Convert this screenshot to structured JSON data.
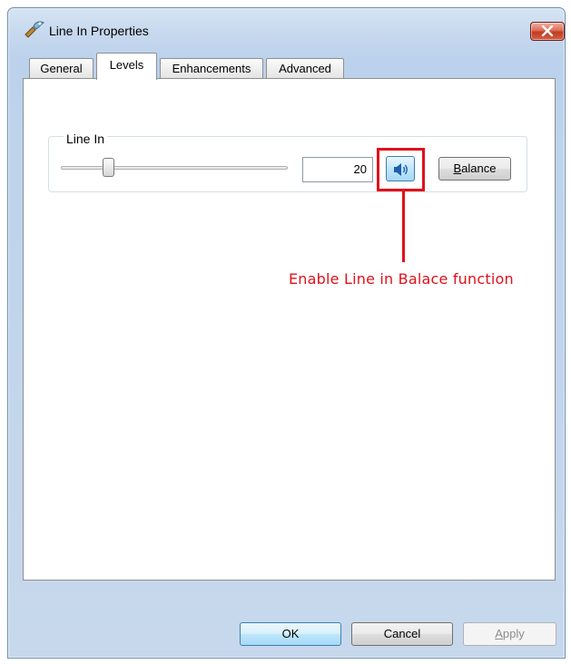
{
  "window": {
    "title": "Line In Properties",
    "icon": "speaker-properties-icon"
  },
  "tabs": [
    {
      "label": "General",
      "active": false
    },
    {
      "label": "Levels",
      "active": true
    },
    {
      "label": "Enhancements",
      "active": false
    },
    {
      "label": "Advanced",
      "active": false
    }
  ],
  "levels": {
    "group_label": "Line In",
    "slider_value_fraction": 0.2,
    "value": "20",
    "mute_button_icon": "speaker-icon",
    "balance_label_prefix": "B",
    "balance_label_rest": "alance"
  },
  "annotation": {
    "text": "Enable Line in Balace function",
    "color": "#e0101a"
  },
  "footer": {
    "ok_label": "OK",
    "cancel_label": "Cancel",
    "apply_label_prefix": "A",
    "apply_label_rest": "pply"
  }
}
